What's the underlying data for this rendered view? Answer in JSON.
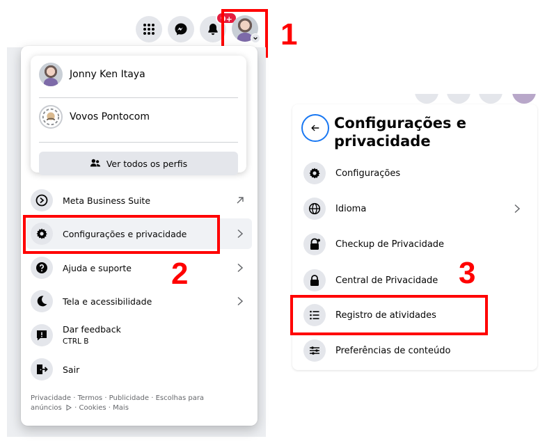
{
  "nav": {
    "icons": [
      "menu-grid-icon",
      "messenger-icon",
      "bell-icon",
      "account-avatar"
    ],
    "notification_badge": "9+"
  },
  "step_labels": {
    "one": "1",
    "two": "2",
    "three": "3"
  },
  "account_menu": {
    "profiles": [
      {
        "name": "Jonny Ken Itaya"
      },
      {
        "name": "Vovos Pontocom"
      }
    ],
    "see_all_profiles": "Ver todos os perfis",
    "items": [
      {
        "label": "Meta Business Suite",
        "icon": "meta-business-icon",
        "trailing": "external-arrow"
      },
      {
        "label": "Configurações e privacidade",
        "icon": "gear-icon",
        "trailing": "chevron"
      },
      {
        "label": "Ajuda e suporte",
        "icon": "question-icon",
        "trailing": "chevron"
      },
      {
        "label": "Tela e acessibilidade",
        "icon": "moon-icon",
        "trailing": "chevron"
      },
      {
        "label": "Dar feedback",
        "sublabel": "CTRL B",
        "icon": "feedback-icon"
      },
      {
        "label": "Sair",
        "icon": "logout-icon"
      }
    ],
    "footer": {
      "line1": "Privacidade · Termos · Publicidade · Escolhas para",
      "line2_start": "anúncios",
      "line2_end": " · Cookies · Mais"
    }
  },
  "settings_panel": {
    "title": "Configurações e privacidade",
    "items": [
      {
        "label": "Configurações",
        "icon": "gear-icon"
      },
      {
        "label": "Idioma",
        "icon": "globe-icon",
        "trailing": "chevron"
      },
      {
        "label": "Checkup de Privacidade",
        "icon": "lock-check-icon"
      },
      {
        "label": "Central de Privacidade",
        "icon": "lock-icon"
      },
      {
        "label": "Registro de atividades",
        "icon": "list-icon"
      },
      {
        "label": "Preferências de conteúdo",
        "icon": "sliders-icon"
      }
    ]
  },
  "colors": {
    "highlight": "#ff0000",
    "accent": "#1877f2",
    "icon_bg": "#e4e6eb",
    "badge": "#e41e3f"
  }
}
